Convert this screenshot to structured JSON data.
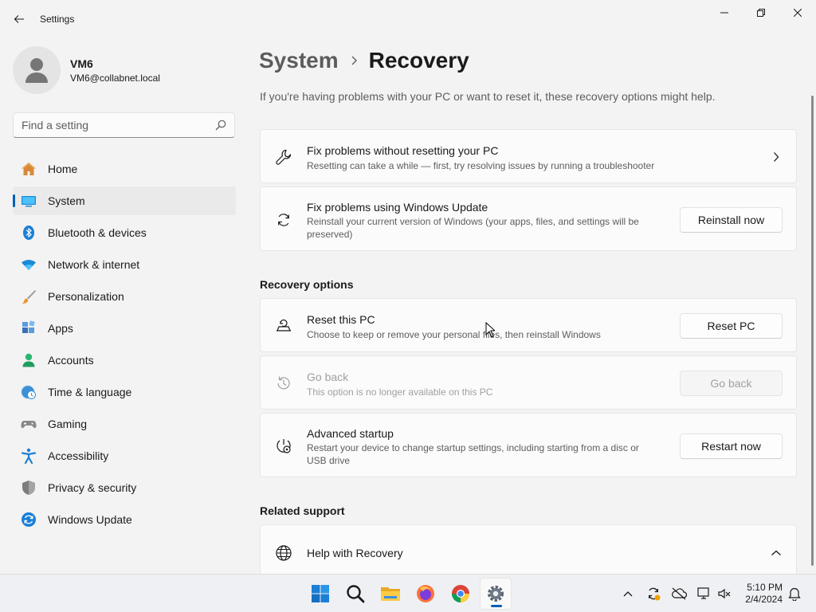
{
  "window": {
    "title": "Settings"
  },
  "profile": {
    "name": "VM6",
    "email": "VM6@collabnet.local"
  },
  "search": {
    "placeholder": "Find a setting"
  },
  "sidebar": {
    "items": [
      {
        "label": "Home",
        "icon": "home-icon"
      },
      {
        "label": "System",
        "icon": "system-icon",
        "active": true
      },
      {
        "label": "Bluetooth & devices",
        "icon": "bluetooth-icon"
      },
      {
        "label": "Network & internet",
        "icon": "wifi-icon"
      },
      {
        "label": "Personalization",
        "icon": "brush-icon"
      },
      {
        "label": "Apps",
        "icon": "apps-icon"
      },
      {
        "label": "Accounts",
        "icon": "accounts-icon"
      },
      {
        "label": "Time & language",
        "icon": "globe-clock-icon"
      },
      {
        "label": "Gaming",
        "icon": "gamepad-icon"
      },
      {
        "label": "Accessibility",
        "icon": "accessibility-icon"
      },
      {
        "label": "Privacy & security",
        "icon": "shield-icon"
      },
      {
        "label": "Windows Update",
        "icon": "update-icon"
      }
    ]
  },
  "breadcrumb": {
    "parent": "System",
    "current": "Recovery"
  },
  "intro": "If you're having problems with your PC or want to reset it, these recovery options might help.",
  "cards": {
    "fix_without_reset": {
      "title": "Fix problems without resetting your PC",
      "desc": "Resetting can take a while — first, try resolving issues by running a troubleshooter"
    },
    "fix_update": {
      "title": "Fix problems using Windows Update",
      "desc": "Reinstall your current version of Windows (your apps, files, and settings will be preserved)",
      "button": "Reinstall now"
    }
  },
  "recovery_options": {
    "heading": "Recovery options",
    "reset": {
      "title": "Reset this PC",
      "desc": "Choose to keep or remove your personal files, then reinstall Windows",
      "button": "Reset PC"
    },
    "go_back": {
      "title": "Go back",
      "desc": "This option is no longer available on this PC",
      "button": "Go back",
      "disabled": true
    },
    "advanced": {
      "title": "Advanced startup",
      "desc": "Restart your device to change startup settings, including starting from a disc or USB drive",
      "button": "Restart now"
    }
  },
  "related_support": {
    "heading": "Related support",
    "help": {
      "title": "Help with Recovery"
    }
  },
  "taskbar": {
    "apps": [
      "start-icon",
      "search-icon",
      "file-explorer-icon",
      "firefox-icon",
      "chrome-icon",
      "settings-icon"
    ],
    "active_app": "settings-icon",
    "time": "5:10 PM",
    "date": "2/4/2024"
  },
  "colors": {
    "accent": "#005fb8",
    "window_bg": "#f3f3f3",
    "card_bg": "#fbfbfb"
  }
}
